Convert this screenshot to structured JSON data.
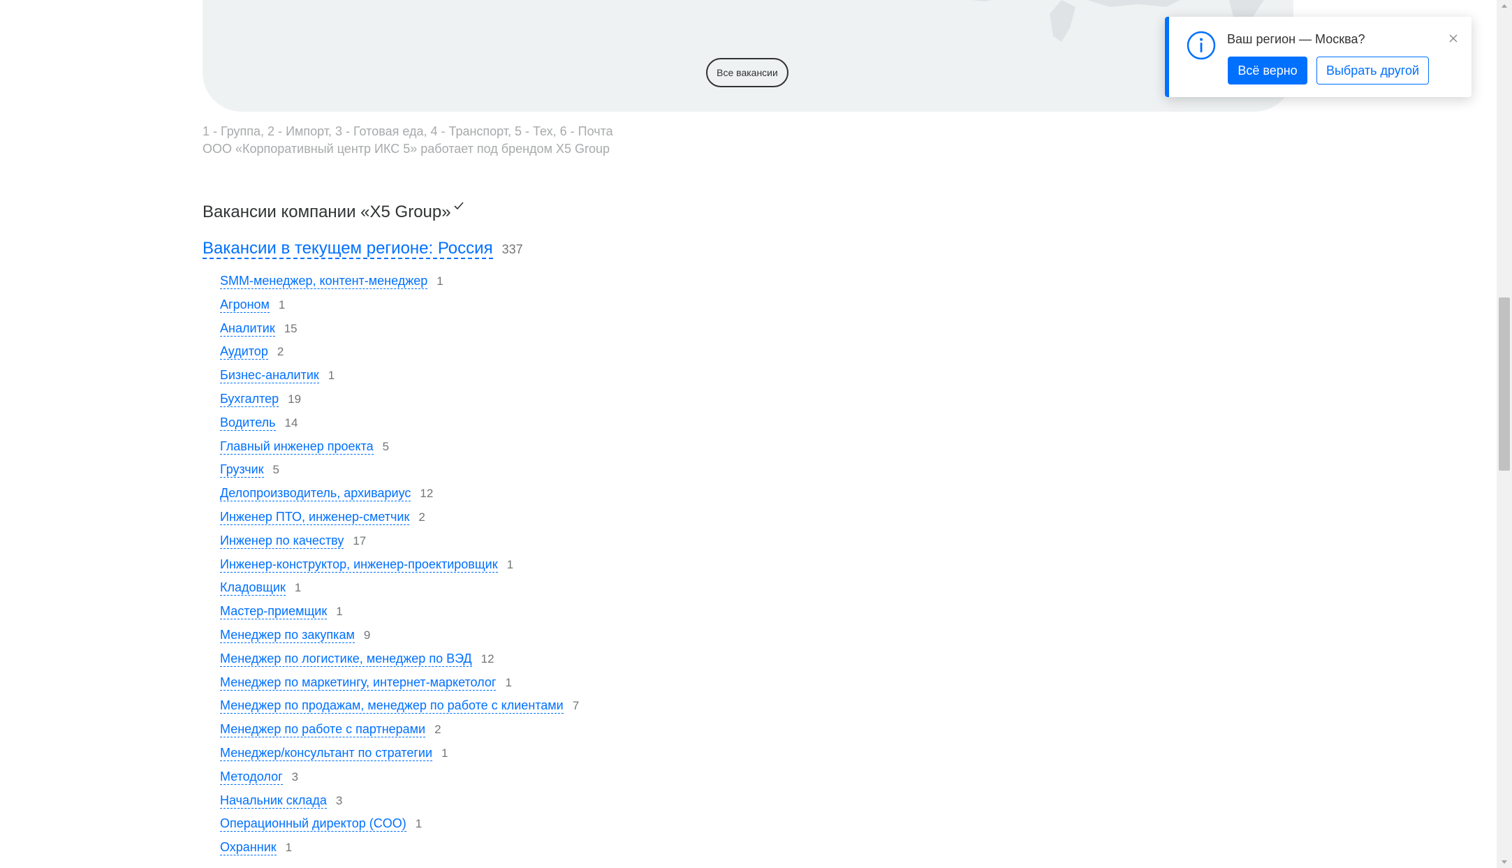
{
  "map": {
    "all_vacancies_button": "Все вакансии"
  },
  "footnote": {
    "line1": "1 - Группа, 2 - Импорт, 3 - Готовая еда, 4 - Транспорт, 5 - Тех, 6 - Почта",
    "line2": "ООО «Корпоративный центр ИКС 5» работает под брендом X5 Group"
  },
  "vacancies": {
    "title": "Вакансии компании «X5 Group»",
    "region_label": "Вакансии в текущем регионе: Россия",
    "region_count": "337",
    "items": [
      {
        "label": "SMM-менеджер, контент-менеджер",
        "count": "1"
      },
      {
        "label": "Агроном",
        "count": "1"
      },
      {
        "label": "Аналитик",
        "count": "15"
      },
      {
        "label": "Аудитор",
        "count": "2"
      },
      {
        "label": "Бизнес-аналитик",
        "count": "1"
      },
      {
        "label": "Бухгалтер",
        "count": "19"
      },
      {
        "label": "Водитель",
        "count": "14"
      },
      {
        "label": "Главный инженер проекта",
        "count": "5"
      },
      {
        "label": "Грузчик",
        "count": "5"
      },
      {
        "label": "Делопроизводитель, архивариус",
        "count": "12"
      },
      {
        "label": "Инженер ПТО, инженер-сметчик",
        "count": "2"
      },
      {
        "label": "Инженер по качеству",
        "count": "17"
      },
      {
        "label": "Инженер-конструктор, инженер-проектировщик",
        "count": "1"
      },
      {
        "label": "Кладовщик",
        "count": "1"
      },
      {
        "label": "Мастер-приемщик",
        "count": "1"
      },
      {
        "label": "Менеджер по закупкам",
        "count": "9"
      },
      {
        "label": "Менеджер по логистике, менеджер по ВЭД",
        "count": "12"
      },
      {
        "label": "Менеджер по маркетингу, интернет-маркетолог",
        "count": "1"
      },
      {
        "label": "Менеджер по продажам, менеджер по работе с клиентами",
        "count": "7"
      },
      {
        "label": "Менеджер по работе с партнерами",
        "count": "2"
      },
      {
        "label": "Менеджер/консультант по стратегии",
        "count": "1"
      },
      {
        "label": "Методолог",
        "count": "3"
      },
      {
        "label": "Начальник склада",
        "count": "3"
      },
      {
        "label": "Операционный директор (COO)",
        "count": "1"
      },
      {
        "label": "Охранник",
        "count": "1"
      }
    ]
  },
  "region_popup": {
    "question": "Ваш регион — Москва?",
    "confirm_label": "Всё верно",
    "choose_other_label": "Выбрать другой"
  },
  "colors": {
    "link": "#0070ff",
    "map_green": "#65b32e",
    "map_bg": "#eff2f3"
  }
}
